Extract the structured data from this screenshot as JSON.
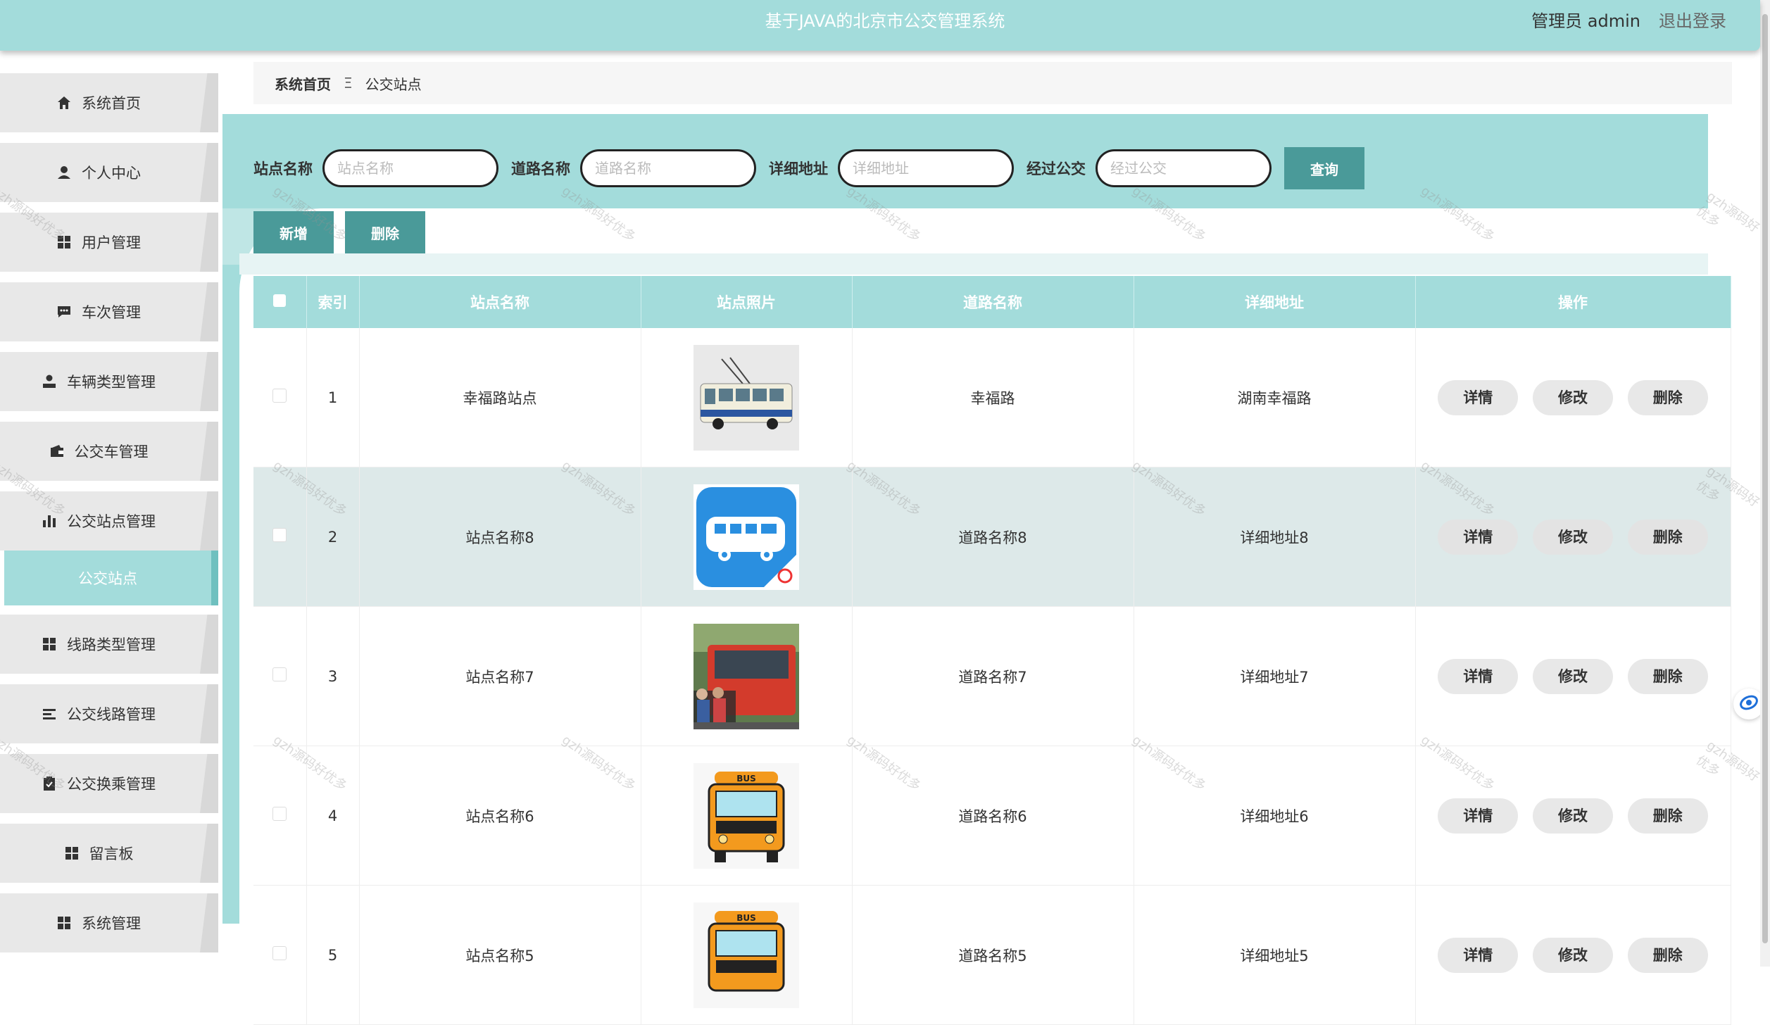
{
  "header": {
    "title": "基于JAVA的北京市公交管理系统",
    "user": "管理员 admin",
    "logout": "退出登录"
  },
  "sidebar": {
    "items": [
      {
        "label": "系统首页",
        "icon": "home-icon"
      },
      {
        "label": "个人中心",
        "icon": "person-icon"
      },
      {
        "label": "用户管理",
        "icon": "grid-icon"
      },
      {
        "label": "车次管理",
        "icon": "chat-icon"
      },
      {
        "label": "车辆类型管理",
        "icon": "user-icon"
      },
      {
        "label": "公交车管理",
        "icon": "wallet-icon"
      },
      {
        "label": "公交站点管理",
        "icon": "bar-chart-icon"
      },
      {
        "label": "线路类型管理",
        "icon": "grid-icon"
      },
      {
        "label": "公交线路管理",
        "icon": "list-icon"
      },
      {
        "label": "公交换乘管理",
        "icon": "clipboard-icon"
      },
      {
        "label": "留言板",
        "icon": "grid-icon"
      },
      {
        "label": "系统管理",
        "icon": "grid-icon"
      }
    ],
    "active_sub": "公交站点"
  },
  "breadcrumb": {
    "home": "系统首页",
    "sep": "Ξ",
    "current": "公交站点"
  },
  "search": {
    "station_label": "站点名称",
    "station_placeholder": "站点名称",
    "road_label": "道路名称",
    "road_placeholder": "道路名称",
    "address_label": "详细地址",
    "address_placeholder": "详细地址",
    "bus_label": "经过公交",
    "bus_placeholder": "经过公交",
    "query_button": "查询"
  },
  "actions": {
    "add": "新增",
    "delete": "删除"
  },
  "table": {
    "columns": [
      "索引",
      "站点名称",
      "站点照片",
      "道路名称",
      "详细地址",
      "操作"
    ],
    "rows": [
      {
        "index": "1",
        "station": "幸福路站点",
        "photo": "trolleybus-photo",
        "road": "幸福路",
        "address": "湖南幸福路"
      },
      {
        "index": "2",
        "station": "站点名称8",
        "photo": "bus-app-icon",
        "road": "道路名称8",
        "address": "详细地址8"
      },
      {
        "index": "3",
        "station": "站点名称7",
        "photo": "red-bus-photo",
        "road": "道路名称7",
        "address": "详细地址7"
      },
      {
        "index": "4",
        "station": "站点名称6",
        "photo": "school-bus-icon",
        "road": "道路名称6",
        "address": "详细地址6"
      },
      {
        "index": "5",
        "station": "站点名称5",
        "photo": "school-bus-icon",
        "road": "道路名称5",
        "address": "详细地址5"
      }
    ],
    "row_actions": {
      "detail": "详情",
      "edit": "修改",
      "delete": "删除"
    }
  },
  "watermark": "gzh源码好优多",
  "colors": {
    "accent": "#a3dcdb",
    "button": "#4a9a99",
    "alt_row": "#dde9e9"
  }
}
